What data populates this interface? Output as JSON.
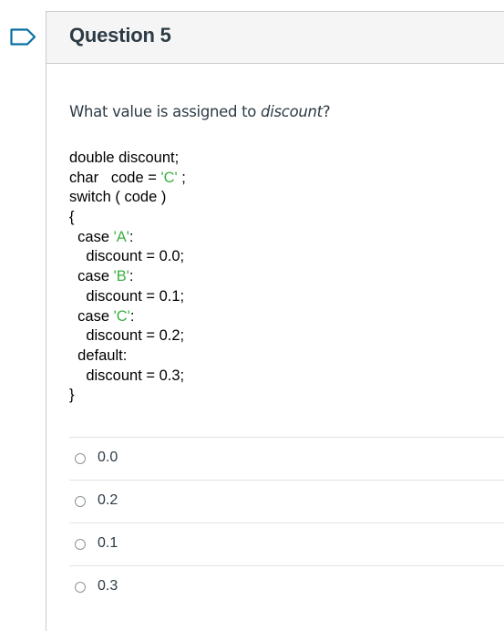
{
  "question": {
    "title": "Question 5",
    "prompt_prefix": "What value is assigned to ",
    "prompt_emphasis": "discount",
    "prompt_suffix": "?"
  },
  "code": {
    "lines": [
      {
        "indent": "",
        "text": "double discount;",
        "str": "",
        "after": ""
      },
      {
        "indent": "",
        "text": "char   code = ",
        "str": "'C'",
        "after": " ;"
      },
      {
        "indent": "",
        "text": "switch ( code )",
        "str": "",
        "after": ""
      },
      {
        "indent": "",
        "text": "{",
        "str": "",
        "after": ""
      },
      {
        "indent": "  ",
        "text": "case ",
        "str": "'A'",
        "after": ":"
      },
      {
        "indent": "    ",
        "text": "discount = 0.0;",
        "str": "",
        "after": ""
      },
      {
        "indent": "  ",
        "text": "case ",
        "str": "'B'",
        "after": ":"
      },
      {
        "indent": "    ",
        "text": "discount = 0.1;",
        "str": "",
        "after": ""
      },
      {
        "indent": "  ",
        "text": "case ",
        "str": "'C'",
        "after": ":"
      },
      {
        "indent": "    ",
        "text": "discount = 0.2;",
        "str": "",
        "after": ""
      },
      {
        "indent": "  ",
        "text": "default:",
        "str": "",
        "after": ""
      },
      {
        "indent": "    ",
        "text": "discount = 0.3;",
        "str": "",
        "after": ""
      },
      {
        "indent": "",
        "text": "}",
        "str": "",
        "after": ""
      }
    ],
    "string_color": "#3cb043"
  },
  "answers": [
    {
      "label": "0.0",
      "selected": false
    },
    {
      "label": "0.2",
      "selected": false
    },
    {
      "label": "0.1",
      "selected": false
    },
    {
      "label": "0.3",
      "selected": false
    }
  ],
  "icons": {
    "flag": "flag-icon"
  },
  "colors": {
    "flag": "#0770a3",
    "header_bg": "#f5f5f5",
    "text": "#2d3b45"
  }
}
